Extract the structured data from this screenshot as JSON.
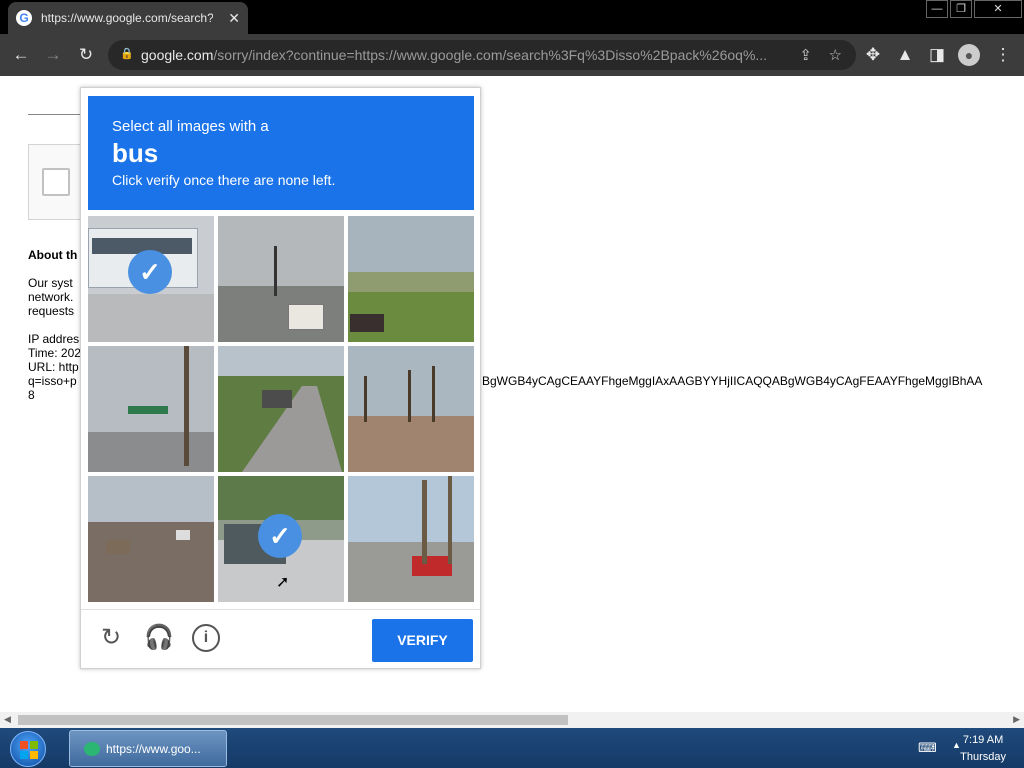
{
  "browser": {
    "tab_title": "https://www.google.com/search?q=",
    "tab_close": "✕",
    "url_domain": "google.com",
    "url_rest": "/sorry/index?continue=https://www.google.com/search%3Fq%3Disso%2Bpack%26oq%...",
    "window_buttons": [
      "—",
      "❐",
      "✕"
    ]
  },
  "page": {
    "about_heading": "About th",
    "lines": [
      "Our syst",
      "network.",
      "requests",
      "IP addres",
      "Time: 202",
      "URL: http",
      "q=isso+p",
      "8"
    ],
    "long_url_tail": "BgWGB4yCAgCEAAYFhgeMggIAxAAGBYYHjIICAQQABgWGB4yCAgFEAAYFhgeMggIBhAA"
  },
  "captcha": {
    "line1": "Select all images with a",
    "keyword": "bus",
    "line3": "Click verify once there are none left.",
    "verify_label": "VERIFY",
    "tiles": [
      {
        "selected": true
      },
      {
        "selected": false
      },
      {
        "selected": false
      },
      {
        "selected": false
      },
      {
        "selected": false
      },
      {
        "selected": false
      },
      {
        "selected": false
      },
      {
        "selected": true
      },
      {
        "selected": false
      }
    ],
    "check_glyph": "✓",
    "icons": [
      "reload-icon",
      "headphones-icon",
      "info-icon"
    ]
  },
  "taskbar": {
    "item_label": "https://www.goo...",
    "time": "7:19 AM",
    "day": "Thursday"
  }
}
